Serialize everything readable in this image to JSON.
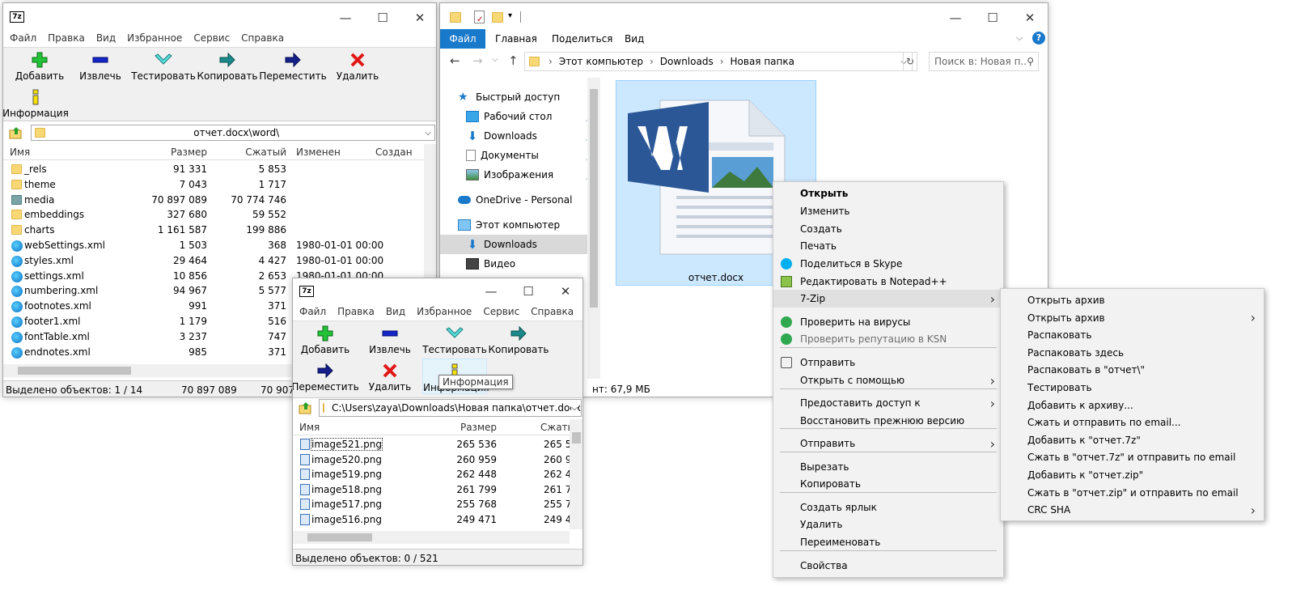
{
  "win7z_main": {
    "logo": "7z",
    "menu": [
      "Файл",
      "Правка",
      "Вид",
      "Избранное",
      "Сервис",
      "Справка"
    ],
    "toolbar": {
      "add": "Добавить",
      "extract": "Извлечь",
      "test": "Тестировать",
      "copy": "Копировать",
      "move": "Переместить",
      "delete": "Удалить",
      "info": "Информация"
    },
    "path": "отчет.docx\\word\\",
    "columns": {
      "name": "Имя",
      "size": "Размер",
      "packed": "Сжатый",
      "modified": "Изменен",
      "created": "Создан"
    },
    "rows": [
      {
        "name": "_rels",
        "size": "91 331",
        "packed": "5 853",
        "modified": "",
        "type": "folder"
      },
      {
        "name": "theme",
        "size": "7 043",
        "packed": "1 717",
        "modified": "",
        "type": "folder"
      },
      {
        "name": "media",
        "size": "70 897 089",
        "packed": "70 774 746",
        "modified": "",
        "type": "media"
      },
      {
        "name": "embeddings",
        "size": "327 680",
        "packed": "59 552",
        "modified": "",
        "type": "folder"
      },
      {
        "name": "charts",
        "size": "1 161 587",
        "packed": "199 886",
        "modified": "",
        "type": "folder"
      },
      {
        "name": "webSettings.xml",
        "size": "1 503",
        "packed": "368",
        "modified": "1980-01-01 00:00",
        "type": "xml"
      },
      {
        "name": "styles.xml",
        "size": "29 464",
        "packed": "4 427",
        "modified": "1980-01-01 00:00",
        "type": "xml"
      },
      {
        "name": "settings.xml",
        "size": "10 856",
        "packed": "2 653",
        "modified": "1980-01-01 00:00",
        "type": "xml"
      },
      {
        "name": "numbering.xml",
        "size": "94 967",
        "packed": "5 577",
        "modified": "",
        "type": "xml"
      },
      {
        "name": "footnotes.xml",
        "size": "991",
        "packed": "371",
        "modified": "",
        "type": "xml"
      },
      {
        "name": "footer1.xml",
        "size": "1 179",
        "packed": "516",
        "modified": "",
        "type": "xml"
      },
      {
        "name": "fontTable.xml",
        "size": "3 237",
        "packed": "747",
        "modified": "",
        "type": "xml"
      },
      {
        "name": "endnotes.xml",
        "size": "985",
        "packed": "371",
        "modified": "",
        "type": "xml"
      }
    ],
    "status": {
      "selected": "Выделено объектов: 1 / 14",
      "size": "70 897 089",
      "packed": "70 907 0"
    }
  },
  "explorer": {
    "ribbon_tabs": [
      "Файл",
      "Главная",
      "Поделиться",
      "Вид"
    ],
    "breadcrumb": [
      "Этот компьютер",
      "Downloads",
      "Новая папка"
    ],
    "search_placeholder": "Поиск в: Новая п...",
    "nav": {
      "quick_access": "Быстрый доступ",
      "desktop": "Рабочий стол",
      "downloads": "Downloads",
      "documents": "Документы",
      "pictures": "Изображения",
      "onedrive": "OneDrive - Personal",
      "this_pc": "Этот компьютер",
      "pc_downloads": "Downloads",
      "video": "Видео"
    },
    "file_name": "отчет.docx",
    "status_size": "нт: 67,9 МБ"
  },
  "win7z_second": {
    "logo": "7z",
    "menu": [
      "Файл",
      "Правка",
      "Вид",
      "Избранное",
      "Сервис",
      "Справка"
    ],
    "toolbar": {
      "add": "Добавить",
      "extract": "Извлечь",
      "test": "Тестировать",
      "copy": "Копировать",
      "move": "Переместить",
      "delete": "Удалить",
      "info": "Информация"
    },
    "tooltip": "Информация",
    "path": "C:\\Users\\zaya\\Downloads\\Новая папка\\отчет.docx\\w",
    "columns": {
      "name": "Имя",
      "size": "Размер",
      "packed": "Сжать"
    },
    "rows": [
      {
        "name": "image521.png",
        "size": "265 536",
        "packed": "265 5"
      },
      {
        "name": "image520.png",
        "size": "260 959",
        "packed": "260 9"
      },
      {
        "name": "image519.png",
        "size": "262 448",
        "packed": "262 4"
      },
      {
        "name": "image518.png",
        "size": "261 799",
        "packed": "261 7"
      },
      {
        "name": "image517.png",
        "size": "255 768",
        "packed": "255 7"
      },
      {
        "name": "image516.png",
        "size": "249 471",
        "packed": "249 4"
      }
    ],
    "status": "Выделено объектов: 0 / 521"
  },
  "context_menu": {
    "items": [
      {
        "label": "Открыть",
        "bold": true
      },
      {
        "label": "Изменить"
      },
      {
        "label": "Создать"
      },
      {
        "label": "Печать"
      },
      {
        "label": "Поделиться в Skype",
        "icon": "skype-icon"
      },
      {
        "label": "Редактировать в Notepad++",
        "icon": "notepadpp-icon"
      },
      {
        "label": "7-Zip",
        "submenu": true
      },
      {
        "label": "Проверить на вирусы",
        "icon": "kaspersky-icon"
      },
      {
        "label": "Проверить репутацию в KSN",
        "icon": "kaspersky-icon",
        "disabled": true
      },
      {
        "label": "Отправить",
        "icon": "share-icon"
      },
      {
        "label": "Открыть с помощью",
        "submenu": true
      },
      {
        "label": "Предоставить доступ к",
        "submenu": true
      },
      {
        "label": "Восстановить прежнюю версию"
      },
      {
        "label": "Отправить",
        "submenu": true
      },
      {
        "label": "Вырезать"
      },
      {
        "label": "Копировать"
      },
      {
        "label": "Создать ярлык"
      },
      {
        "label": "Удалить"
      },
      {
        "label": "Переименовать"
      },
      {
        "label": "Свойства"
      }
    ]
  },
  "submenu_7zip": {
    "items": [
      {
        "label": "Открыть архив"
      },
      {
        "label": "Открыть архив",
        "submenu": true
      },
      {
        "label": "Распаковать"
      },
      {
        "label": "Распаковать здесь"
      },
      {
        "label": "Распаковать в \"отчет\\\""
      },
      {
        "label": "Тестировать"
      },
      {
        "label": "Добавить к архиву..."
      },
      {
        "label": "Сжать и отправить по email..."
      },
      {
        "label": "Добавить к \"отчет.7z\""
      },
      {
        "label": "Сжать в \"отчет.7z\" и отправить по email"
      },
      {
        "label": "Добавить к \"отчет.zip\""
      },
      {
        "label": "Сжать в \"отчет.zip\" и отправить по email"
      },
      {
        "label": "CRC SHA",
        "submenu": true
      }
    ]
  },
  "colors": {
    "accent": "#1979ca",
    "selection": "#cce8ff",
    "ribbon_tab": "#1979ca"
  }
}
